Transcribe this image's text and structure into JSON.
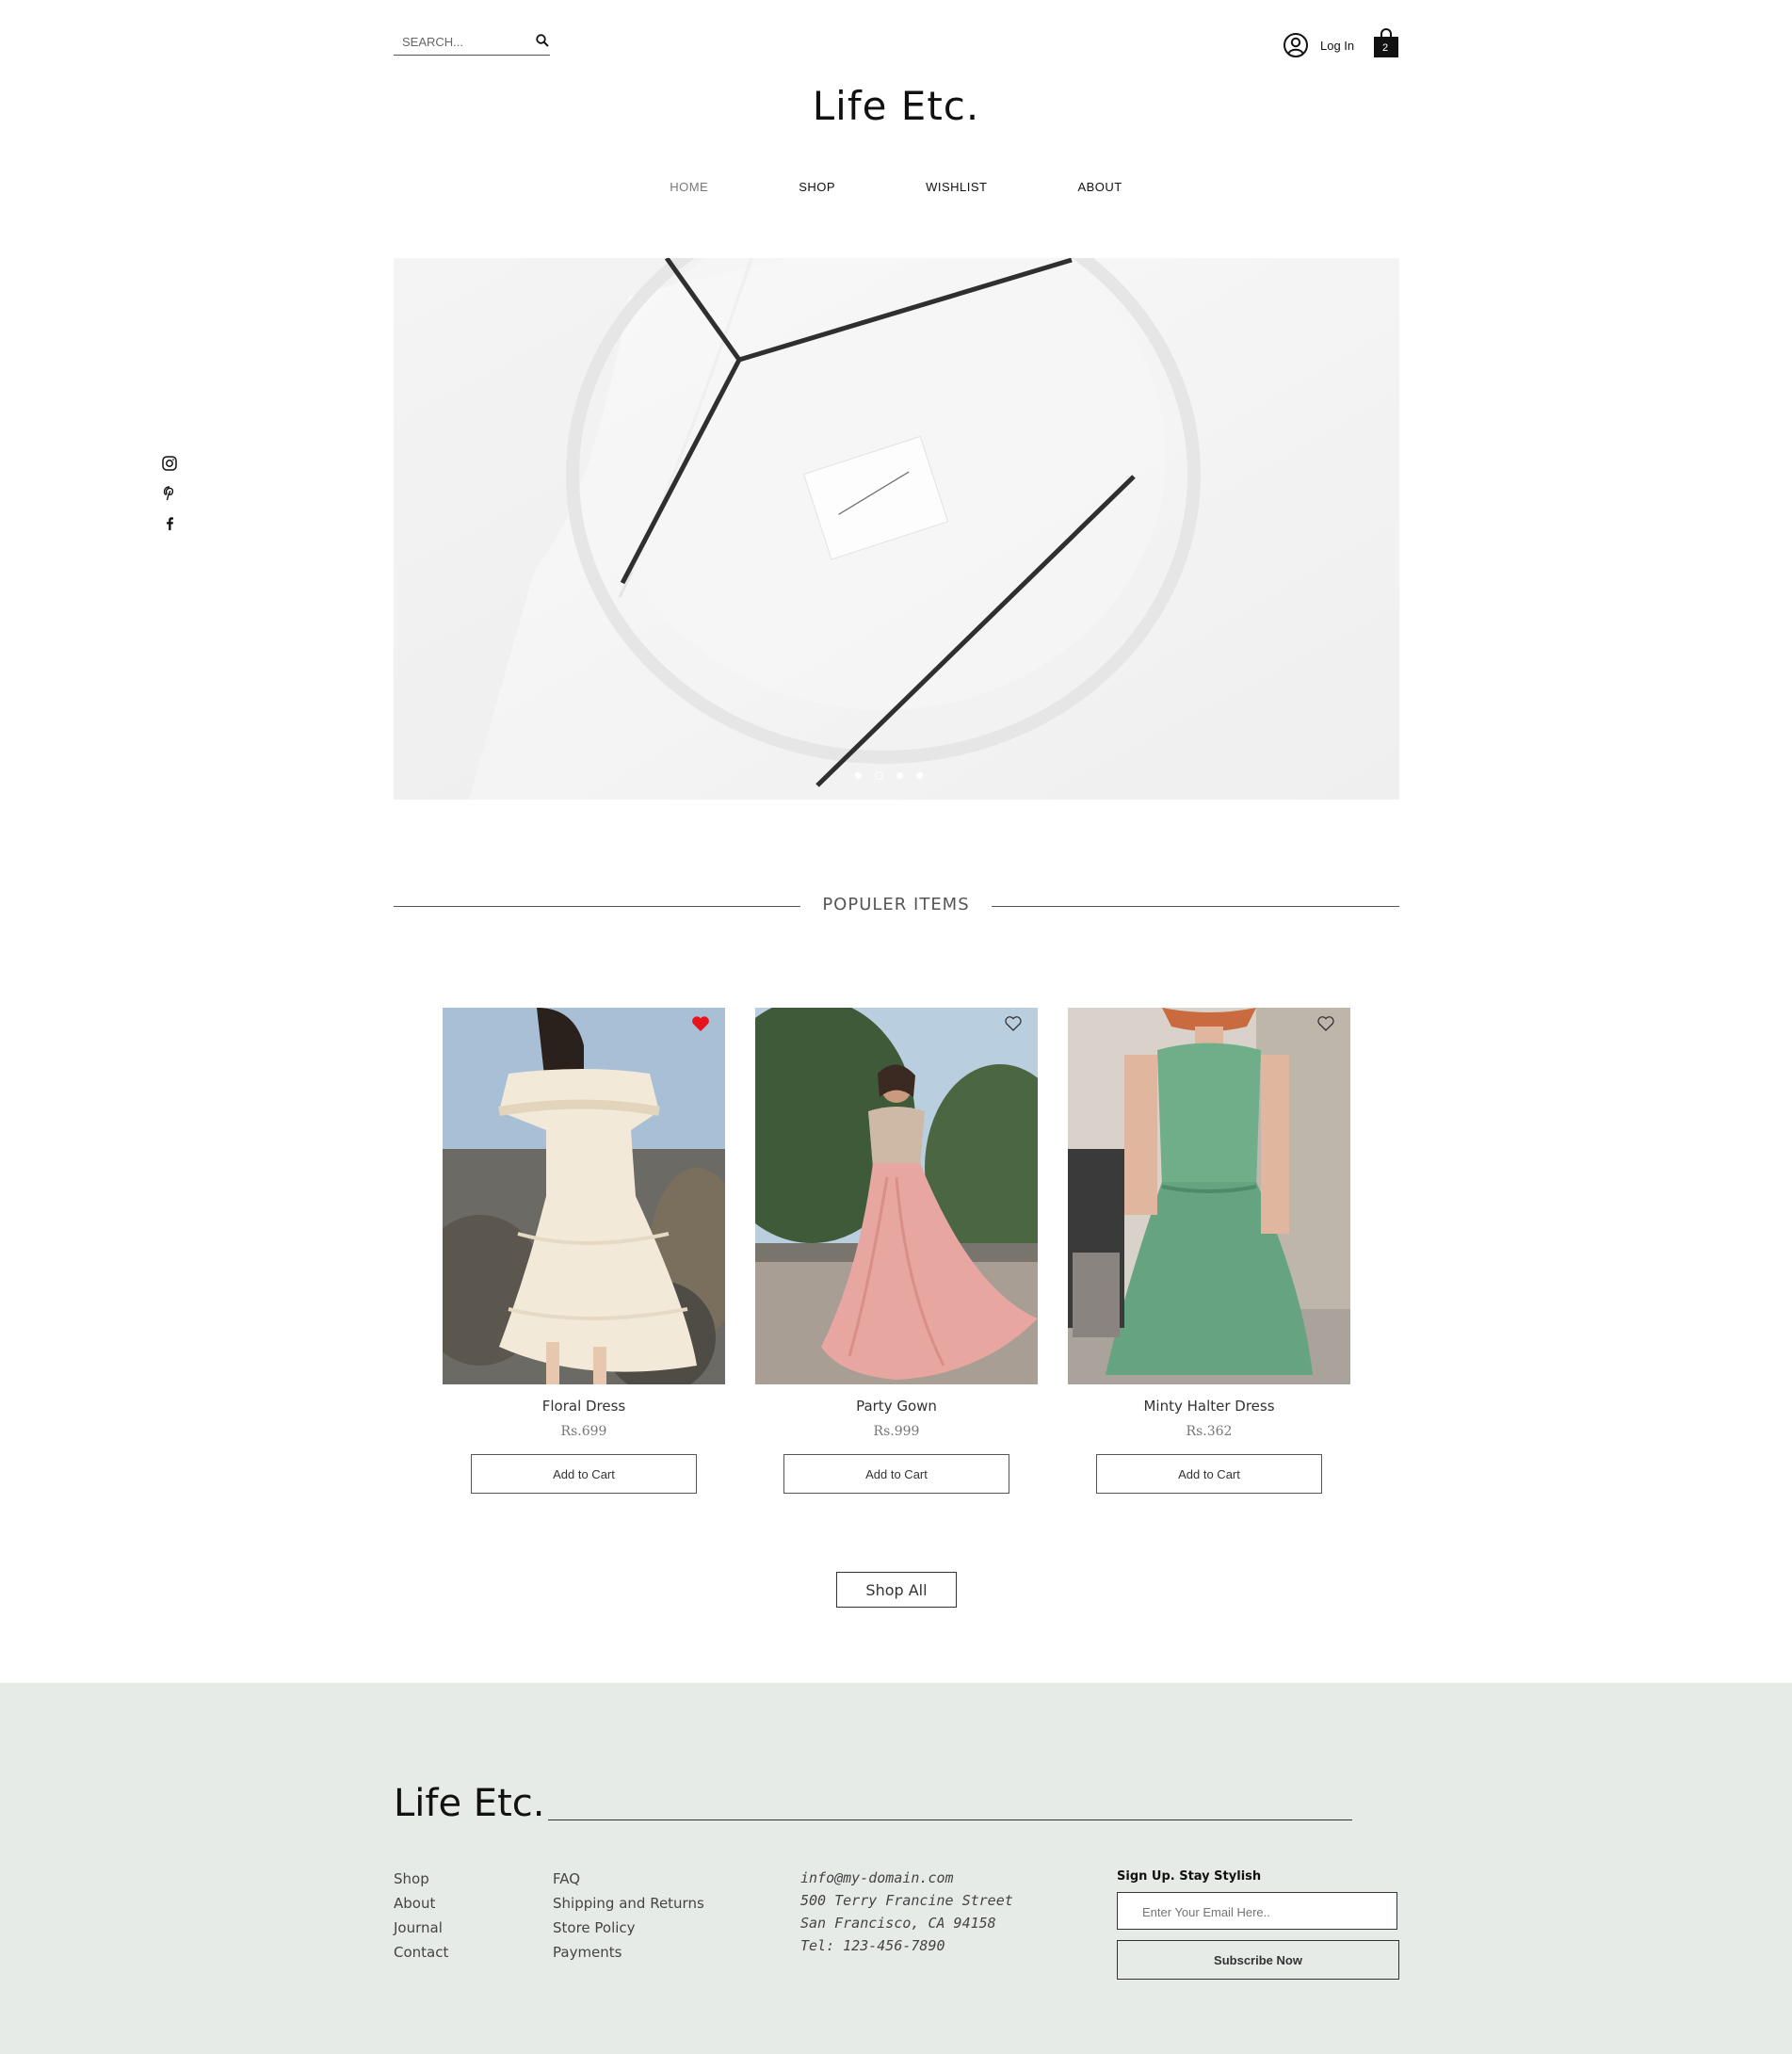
{
  "header": {
    "search_placeholder": "SEARCH...",
    "login_label": "Log In",
    "cart_count": "2",
    "logo": "Life Etc."
  },
  "nav": {
    "items": [
      {
        "label": "HOME",
        "active": true
      },
      {
        "label": "SHOP",
        "active": false
      },
      {
        "label": "WISHLIST",
        "active": false
      },
      {
        "label": "ABOUT",
        "active": false
      }
    ]
  },
  "social": [
    "instagram-icon",
    "pinterest-icon",
    "facebook-icon"
  ],
  "hero": {
    "slide_count": 4,
    "active_slide": 2
  },
  "section": {
    "title": "POPULER ITEMS"
  },
  "products": [
    {
      "name": "Floral Dress",
      "price": "Rs.699",
      "button": "Add to Cart",
      "favorited": true
    },
    {
      "name": "Party Gown",
      "price": "Rs.999",
      "button": "Add to Cart",
      "favorited": false
    },
    {
      "name": "Minty Halter Dress",
      "price": "Rs.362",
      "button": "Add to Cart",
      "favorited": false
    }
  ],
  "shop_all_label": "Shop All",
  "footer": {
    "logo": "Life Etc.",
    "col1": [
      "Shop",
      "About",
      "Journal",
      "Contact"
    ],
    "col2": [
      "FAQ",
      "Shipping and Returns",
      "Store Policy",
      "Payments"
    ],
    "contact": [
      "info@my-domain.com",
      "500 Terry Francine Street",
      "San Francisco, CA 94158",
      "Tel: 123-456-7890"
    ],
    "signup_title": "Sign Up. Stay Stylish",
    "email_placeholder": "Enter Your Email Here..",
    "subscribe_label": "Subscribe Now"
  },
  "colors": {
    "accent_heart": "#e8141b",
    "footer_bg": "#e7ebe8"
  }
}
